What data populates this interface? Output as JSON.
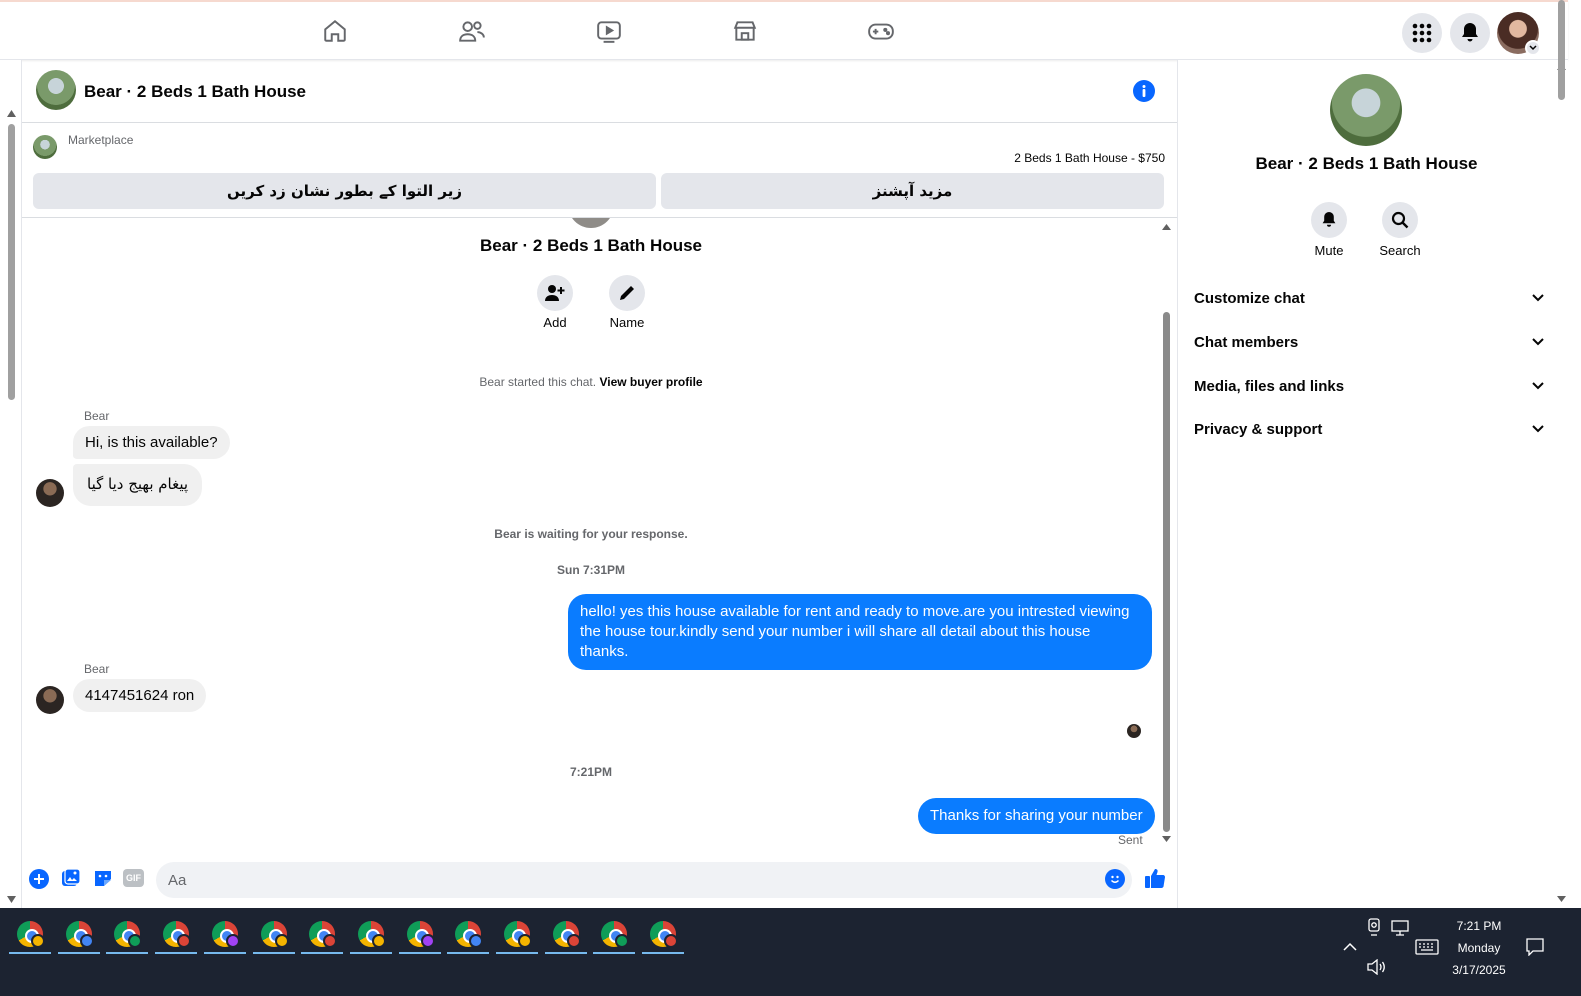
{
  "topbar": {
    "nav_icons": [
      "home-icon",
      "friends-icon",
      "watch-icon",
      "marketplace-icon",
      "gaming-icon"
    ]
  },
  "chat": {
    "title": "Bear · 2 Beds 1 Bath House",
    "banner": {
      "source": "Marketplace",
      "listing": "2 Beds 1 Bath House - $750",
      "left_button": "زیر التوا کے بطور نشان زد کریں",
      "right_button": "مزید آپشنز"
    },
    "intro": {
      "title": "Bear · 2 Beds 1 Bath House",
      "add_label": "Add",
      "name_label": "Name",
      "started_text": "Bear started this chat.",
      "buyer_link": "View buyer profile"
    },
    "messages": {
      "sender1": "Bear",
      "m1": "Hi, is this available?",
      "m2": "پیغام بھیج دیا گیا",
      "waiting": "Bear is waiting for your response.",
      "ts1": "Sun 7:31PM",
      "out1": "hello! yes this house available for rent and ready to move.are you intrested viewing the house tour.kindly send your number i will share all detail about this house thanks.",
      "sender2": "Bear",
      "m3": "4147451624 ron",
      "ts2": "7:21PM",
      "out2": "Thanks for sharing your number",
      "status": "Sent"
    },
    "composer": {
      "placeholder": "Aa"
    }
  },
  "right_panel": {
    "title": "Bear · 2 Beds 1 Bath House",
    "mute_label": "Mute",
    "search_label": "Search",
    "sections": [
      "Customize chat",
      "Chat members",
      "Media, files and links",
      "Privacy & support"
    ]
  },
  "taskbar": {
    "app_count": 14,
    "badge_colors": [
      "#f4b400",
      "#4285f4",
      "#0f9d58",
      "#db4437",
      "#a142f4",
      "#f4b400",
      "#db4437",
      "#f4b400",
      "#a142f4",
      "#4285f4",
      "#f4b400",
      "#db4437",
      "#0f9d58",
      "#db4437"
    ],
    "time": "7:21 PM",
    "day": "Monday",
    "date": "3/17/2025"
  },
  "colors": {
    "accent": "#0a7cff",
    "messenger_blue": "#0866ff",
    "taskbar": "#1c2331"
  }
}
